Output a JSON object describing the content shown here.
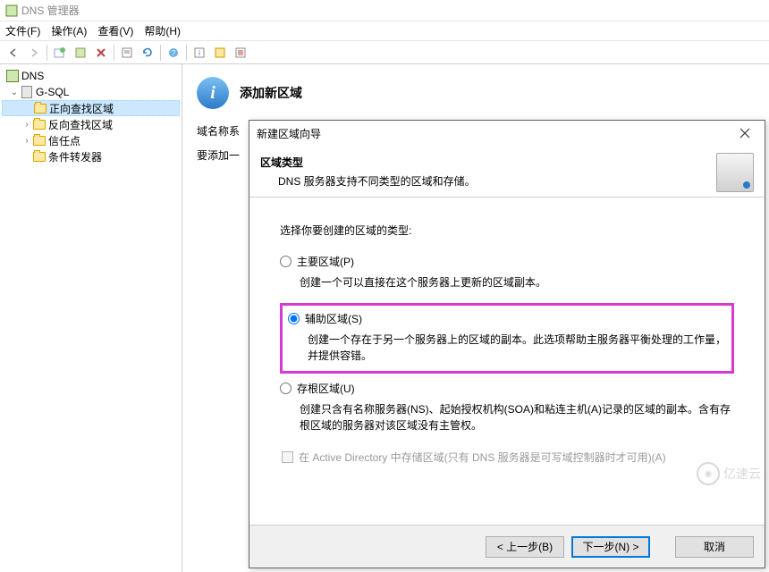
{
  "window": {
    "title": "DNS 管理器"
  },
  "menubar": [
    "文件(F)",
    "操作(A)",
    "查看(V)",
    "帮助(H)"
  ],
  "tree": {
    "root": "DNS",
    "server": "G-SQL",
    "items": [
      {
        "label": "正向查找区域",
        "selected": true
      },
      {
        "label": "反向查找区域",
        "expandable": true
      },
      {
        "label": "信任点",
        "expandable": true
      },
      {
        "label": "条件转发器",
        "expandable": false
      }
    ]
  },
  "content": {
    "header": "添加新区域",
    "line1_prefix": "域名称系",
    "line2_prefix": "要添加一"
  },
  "dialog": {
    "title": "新建区域向导",
    "banner_title": "区域类型",
    "banner_sub": "DNS 服务器支持不同类型的区域和存储。",
    "prompt": "选择你要创建的区域的类型:",
    "opt_primary": {
      "label": "主要区域(P)",
      "desc": "创建一个可以直接在这个服务器上更新的区域副本。"
    },
    "opt_secondary": {
      "label": "辅助区域(S)",
      "desc": "创建一个存在于另一个服务器上的区域的副本。此选项帮助主服务器平衡处理的工作量，并提供容错。"
    },
    "opt_stub": {
      "label": "存根区域(U)",
      "desc": "创建只含有名称服务器(NS)、起始授权机构(SOA)和粘连主机(A)记录的区域的副本。含有存根区域的服务器对该区域没有主管权。"
    },
    "ad_store": "在 Active Directory 中存储区域(只有 DNS 服务器是可写域控制器时才可用)(A)",
    "buttons": {
      "back": "< 上一步(B)",
      "next": "下一步(N) >",
      "cancel": "取消"
    }
  },
  "watermark": "亿速云"
}
